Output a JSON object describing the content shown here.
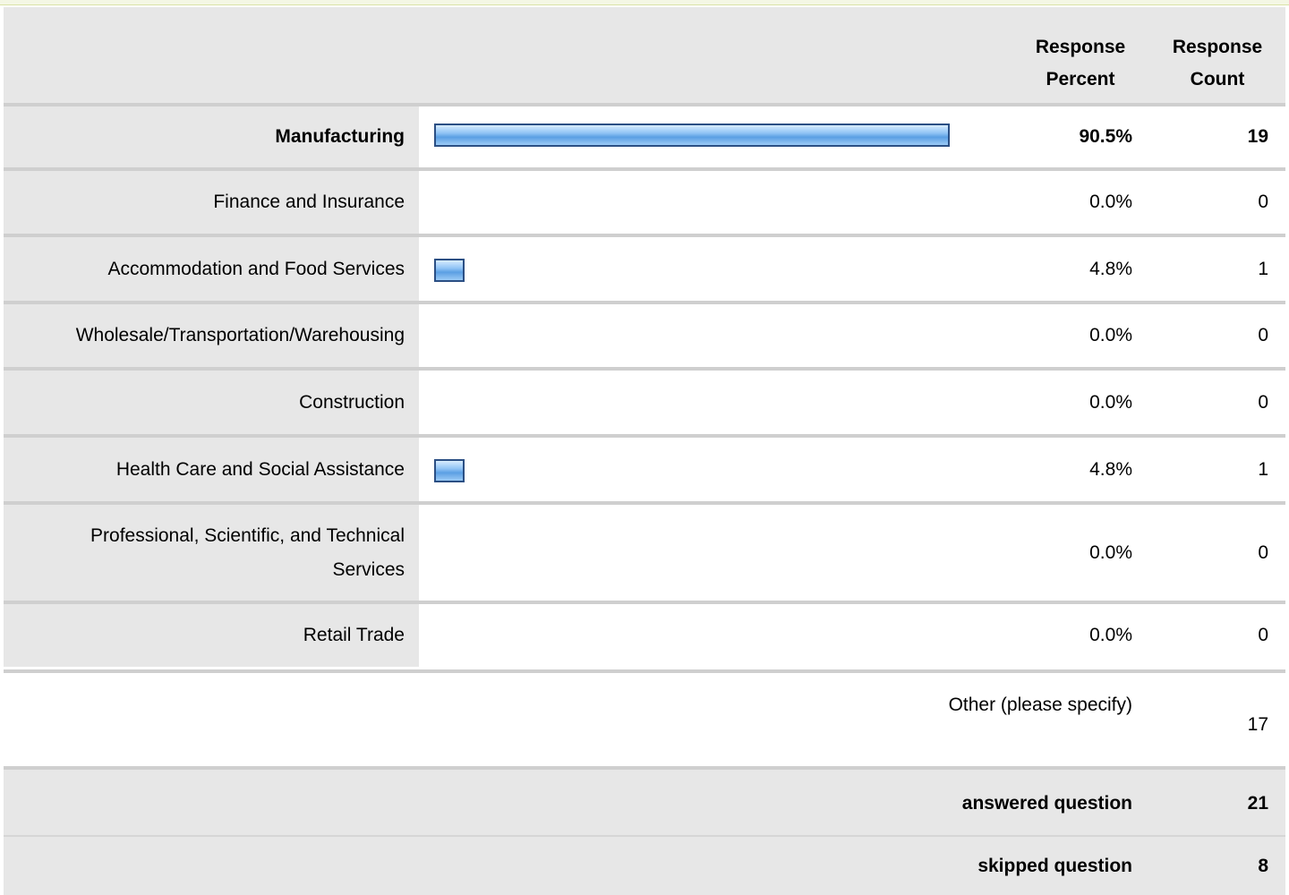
{
  "header": {
    "response_percent": "Response Percent",
    "response_count": "Response Count"
  },
  "rows": [
    {
      "label": "Manufacturing",
      "percent": "90.5%",
      "count": "19",
      "fraction": 0.905,
      "bold": true
    },
    {
      "label": "Finance and Insurance",
      "percent": "0.0%",
      "count": "0",
      "fraction": 0.0
    },
    {
      "label": "Accommodation and Food Services",
      "percent": "4.8%",
      "count": "1",
      "fraction": 0.048
    },
    {
      "label": "Wholesale/Transportation/Warehousing",
      "percent": "0.0%",
      "count": "0",
      "fraction": 0.0
    },
    {
      "label": "Construction",
      "percent": "0.0%",
      "count": "0",
      "fraction": 0.0
    },
    {
      "label": "Health Care and Social Assistance",
      "percent": "4.8%",
      "count": "1",
      "fraction": 0.048
    },
    {
      "label_line1": "Professional, Scientific, and Technical",
      "label_line2": "Services",
      "percent": "0.0%",
      "count": "0",
      "fraction": 0.0
    },
    {
      "label": "Retail Trade",
      "percent": "0.0%",
      "count": "0",
      "fraction": 0.0
    }
  ],
  "other": {
    "label": "Other (please specify)",
    "count": "17"
  },
  "summary": {
    "answered_label": "answered question",
    "answered_count": "21",
    "skipped_label": "skipped question",
    "skipped_count": "8"
  },
  "colors": {
    "row_label_background": "#e7e7e7",
    "bar_border": "#2b4f84",
    "bar_fill": "#8fc3f5"
  }
}
